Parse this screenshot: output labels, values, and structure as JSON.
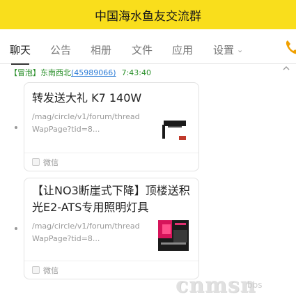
{
  "window": {
    "title": "中国海水鱼友交流群"
  },
  "tabs": [
    {
      "label": "聊天"
    },
    {
      "label": "公告"
    },
    {
      "label": "相册"
    },
    {
      "label": "文件"
    },
    {
      "label": "应用"
    },
    {
      "label": "设置"
    }
  ],
  "accent_color": "#f9de1c",
  "message": {
    "badge": "【冒泡】",
    "sender": "东南西北",
    "uid": "(45989066)",
    "time": "7:43:40"
  },
  "cards": [
    {
      "title": "转发送大礼 K7 140W",
      "url": "/mag/circle/v1/forum/threadWapPage?tid=8...",
      "source": "微信"
    },
    {
      "title": "【让NO3断崖式下降】顶楼送积光E2-ATS专用照明灯具",
      "url": "/mag/circle/v1/forum/threadWapPage?tid=8...",
      "source": "微信"
    }
  ],
  "watermark": {
    "text": "cnmsn",
    "sub": "bbs"
  }
}
